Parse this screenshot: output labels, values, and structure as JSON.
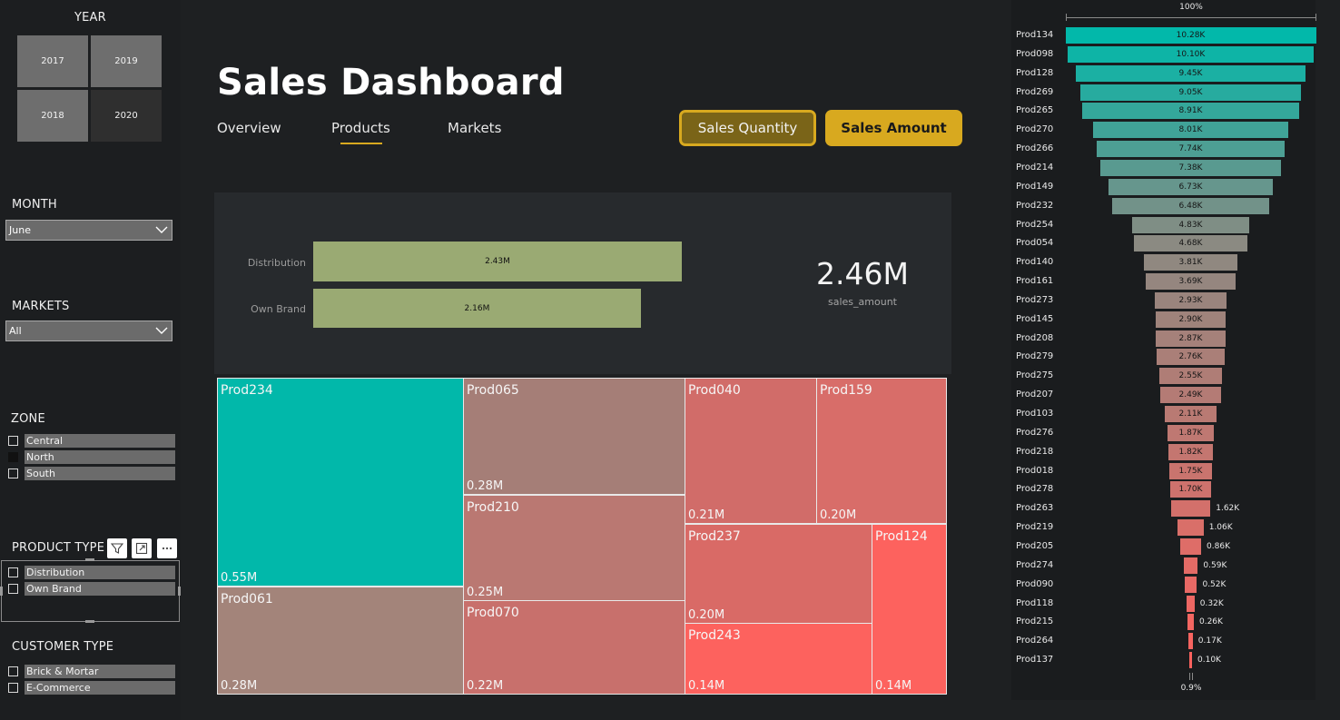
{
  "sidebar": {
    "year": {
      "title": "YEAR",
      "tiles": [
        {
          "label": "2017",
          "selected": false
        },
        {
          "label": "2019",
          "selected": false
        },
        {
          "label": "2018",
          "selected": false
        },
        {
          "label": "2020",
          "selected": true
        }
      ]
    },
    "month": {
      "title": "MONTH",
      "value": "June"
    },
    "markets": {
      "title": "MARKETS",
      "value": "All"
    },
    "zone": {
      "title": "ZONE",
      "items": [
        "Central",
        "North",
        "South"
      ]
    },
    "product_type": {
      "title": "PRODUCT TYPE",
      "items": [
        "Distribution",
        "Own Brand"
      ]
    },
    "customer_type": {
      "title": "CUSTOMER TYPE",
      "items": [
        "Brick & Mortar",
        "E-Commerce"
      ]
    }
  },
  "header": {
    "title": "Sales Dashboard",
    "tabs": [
      {
        "label": "Overview",
        "active": false
      },
      {
        "label": "Products",
        "active": true
      },
      {
        "label": "Markets",
        "active": false
      }
    ],
    "buttons": {
      "quantity": "Sales Quantity",
      "amount": "Sales Amount"
    }
  },
  "colors": {
    "accent": "#d8a91f",
    "teal": "#02b8aa",
    "bar": "#9aaa73",
    "high": "#fd625e"
  },
  "kpi": {
    "value": "2.46M",
    "label": "sales_amount"
  },
  "bar_chart": {
    "categories": [
      "Distribution",
      "Own Brand"
    ],
    "values": [
      2.43,
      2.16
    ],
    "labels": [
      "2.43M",
      "2.16M"
    ],
    "max": 2.43
  },
  "treemap": [
    {
      "name": "Prod234",
      "value": "0.55M"
    },
    {
      "name": "Prod061",
      "value": "0.28M"
    },
    {
      "name": "Prod065",
      "value": "0.28M"
    },
    {
      "name": "Prod210",
      "value": "0.25M"
    },
    {
      "name": "Prod070",
      "value": "0.22M"
    },
    {
      "name": "Prod040",
      "value": "0.21M"
    },
    {
      "name": "Prod159",
      "value": "0.20M"
    },
    {
      "name": "Prod237",
      "value": "0.20M"
    },
    {
      "name": "Prod243",
      "value": "0.14M"
    },
    {
      "name": "Prod124",
      "value": "0.14M"
    }
  ],
  "funnel": {
    "top_label": "100%",
    "bottom_label": "0.9%",
    "items": [
      {
        "name": "Prod134",
        "value": 10.28,
        "label": "10.28K"
      },
      {
        "name": "Prod098",
        "value": 10.1,
        "label": "10.10K"
      },
      {
        "name": "Prod128",
        "value": 9.45,
        "label": "9.45K"
      },
      {
        "name": "Prod269",
        "value": 9.05,
        "label": "9.05K"
      },
      {
        "name": "Prod265",
        "value": 8.91,
        "label": "8.91K"
      },
      {
        "name": "Prod270",
        "value": 8.01,
        "label": "8.01K"
      },
      {
        "name": "Prod266",
        "value": 7.74,
        "label": "7.74K"
      },
      {
        "name": "Prod214",
        "value": 7.38,
        "label": "7.38K"
      },
      {
        "name": "Prod149",
        "value": 6.73,
        "label": "6.73K"
      },
      {
        "name": "Prod232",
        "value": 6.48,
        "label": "6.48K"
      },
      {
        "name": "Prod254",
        "value": 4.83,
        "label": "4.83K"
      },
      {
        "name": "Prod054",
        "value": 4.68,
        "label": "4.68K"
      },
      {
        "name": "Prod140",
        "value": 3.81,
        "label": "3.81K"
      },
      {
        "name": "Prod161",
        "value": 3.69,
        "label": "3.69K"
      },
      {
        "name": "Prod273",
        "value": 2.93,
        "label": "2.93K"
      },
      {
        "name": "Prod145",
        "value": 2.9,
        "label": "2.90K"
      },
      {
        "name": "Prod208",
        "value": 2.87,
        "label": "2.87K"
      },
      {
        "name": "Prod279",
        "value": 2.76,
        "label": "2.76K"
      },
      {
        "name": "Prod275",
        "value": 2.55,
        "label": "2.55K"
      },
      {
        "name": "Prod207",
        "value": 2.49,
        "label": "2.49K"
      },
      {
        "name": "Prod103",
        "value": 2.11,
        "label": "2.11K"
      },
      {
        "name": "Prod276",
        "value": 1.87,
        "label": "1.87K"
      },
      {
        "name": "Prod218",
        "value": 1.82,
        "label": "1.82K"
      },
      {
        "name": "Prod018",
        "value": 1.75,
        "label": "1.75K"
      },
      {
        "name": "Prod278",
        "value": 1.7,
        "label": "1.70K"
      },
      {
        "name": "Prod263",
        "value": 1.62,
        "label": "1.62K"
      },
      {
        "name": "Prod219",
        "value": 1.06,
        "label": "1.06K"
      },
      {
        "name": "Prod205",
        "value": 0.86,
        "label": "0.86K"
      },
      {
        "name": "Prod274",
        "value": 0.59,
        "label": "0.59K"
      },
      {
        "name": "Prod090",
        "value": 0.52,
        "label": "0.52K"
      },
      {
        "name": "Prod118",
        "value": 0.32,
        "label": "0.32K"
      },
      {
        "name": "Prod215",
        "value": 0.26,
        "label": "0.26K"
      },
      {
        "name": "Prod264",
        "value": 0.17,
        "label": "0.17K"
      },
      {
        "name": "Prod137",
        "value": 0.1,
        "label": "0.10K"
      }
    ]
  }
}
